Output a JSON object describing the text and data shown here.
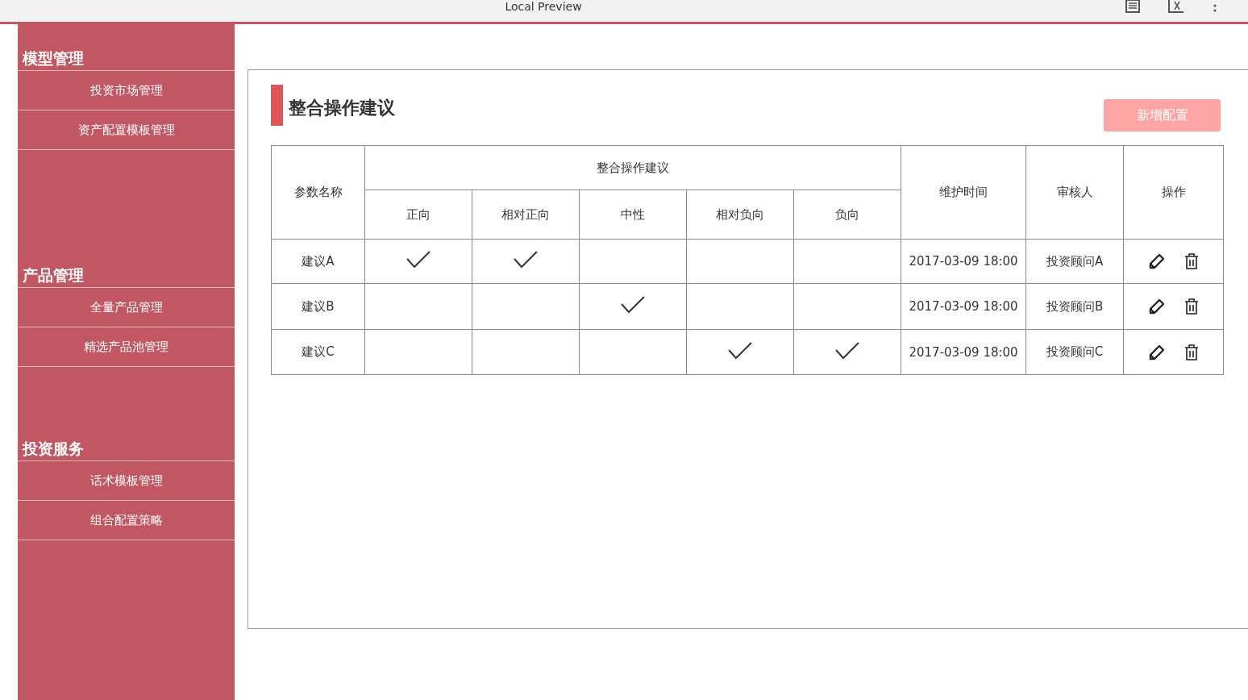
{
  "window": {
    "title": "Local Preview"
  },
  "sidebar": {
    "sections": [
      {
        "title": "模型管理",
        "items": [
          {
            "label": "投资市场管理"
          },
          {
            "label": "资产配置模板管理"
          }
        ]
      },
      {
        "title": "产品管理",
        "items": [
          {
            "label": "全量产品管理"
          },
          {
            "label": "精选产品池管理"
          }
        ]
      },
      {
        "title": "投资服务",
        "items": [
          {
            "label": "话术模板管理"
          },
          {
            "label": "组合配置策略"
          }
        ]
      }
    ]
  },
  "page": {
    "title": "整合操作建议",
    "add_button": "新增配置"
  },
  "table": {
    "col_name": "参数名称",
    "group_header": "整合操作建议",
    "sub_columns": [
      "正向",
      "相对正向",
      "中性",
      "相对负向",
      "负向"
    ],
    "col_time": "维护时间",
    "col_reviewer": "审核人",
    "col_actions": "操作",
    "rows": [
      {
        "name": "建议A",
        "checks": [
          true,
          true,
          false,
          false,
          false
        ],
        "time": "2017-03-09 18:00",
        "reviewer": "投资顾问A"
      },
      {
        "name": "建议B",
        "checks": [
          false,
          false,
          true,
          false,
          false
        ],
        "time": "2017-03-09 18:00",
        "reviewer": "投资顾问B"
      },
      {
        "name": "建议C",
        "checks": [
          false,
          false,
          false,
          true,
          true
        ],
        "time": "2017-03-09 18:00",
        "reviewer": "投资顾问C"
      }
    ]
  }
}
